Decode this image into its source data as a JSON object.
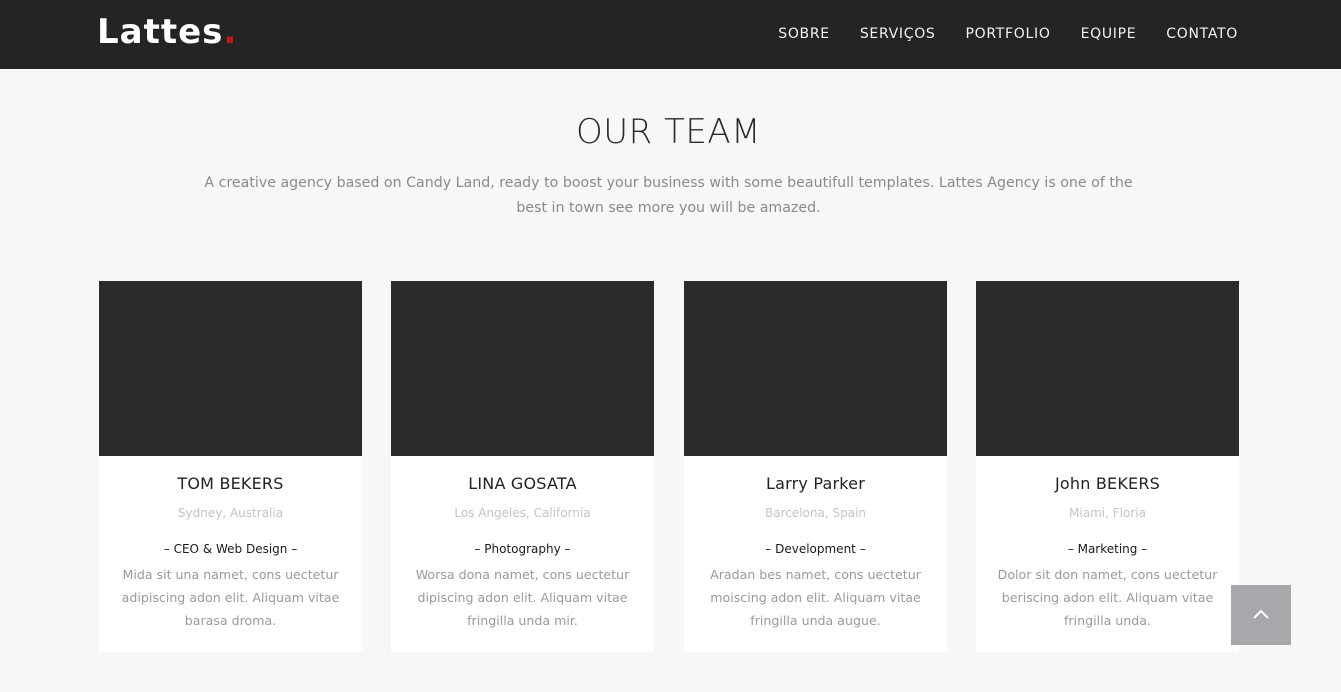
{
  "brand": {
    "name": "Lattes",
    "dot": "."
  },
  "nav": [
    {
      "label": "SOBRE"
    },
    {
      "label": "SERVIÇOS"
    },
    {
      "label": "PORTFOLIO"
    },
    {
      "label": "EQUIPE"
    },
    {
      "label": "CONTATO"
    }
  ],
  "team": {
    "title": "OUR TEAM",
    "description": "A creative agency based on Candy Land, ready to boost your business with some beautifull templates. Lattes Agency is one of the best in town see more you will be amazed.",
    "members": [
      {
        "name": "TOM BEKERS",
        "location": "Sydney, Australia",
        "role": "– CEO & Web Design –",
        "bio": "Mida sit una namet, cons uectetur adipiscing adon elit. Aliquam vitae barasa droma."
      },
      {
        "name": "LINA GOSATA",
        "location": "Los Angeles, California",
        "role": "– Photography –",
        "bio": "Worsa dona namet, cons uectetur dipiscing adon elit. Aliquam vitae fringilla unda mir."
      },
      {
        "name": "Larry Parker",
        "location": "Barcelona, Spain",
        "role": "– Development –",
        "bio": "Aradan bes namet, cons uectetur moiscing adon elit. Aliquam vitae fringilla unda augue."
      },
      {
        "name": "John BEKERS",
        "location": "Miami, Floria",
        "role": "– Marketing –",
        "bio": "Dolor sit don namet, cons uectetur beriscing adon elit. Aliquam vitae fringilla unda."
      }
    ]
  },
  "back_to_top": {
    "icon": "chevron-up-icon"
  },
  "colors": {
    "header_bg": "#242424",
    "accent": "#c5161d",
    "photo_placeholder": "#2b2b2b",
    "page_bg": "#f7f7f7",
    "button_bg": "#a6a8ab"
  }
}
